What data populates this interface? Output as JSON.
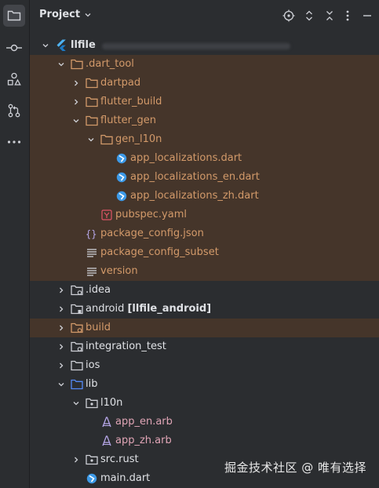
{
  "header": {
    "title": "Project",
    "icons": [
      "locate-icon",
      "expand-collapse-icon",
      "close-all-icon",
      "more-icon",
      "minimize-icon"
    ]
  },
  "sidebar": {
    "items": [
      {
        "name": "folder-icon",
        "active": true
      },
      {
        "name": "commit-icon"
      },
      {
        "name": "structure-icon"
      },
      {
        "name": "pull-requests-icon"
      },
      {
        "name": "more-tools-icon"
      }
    ]
  },
  "tree": {
    "root": "llfile",
    "rows": [
      {
        "label": ".dart_tool"
      },
      {
        "label": "dartpad"
      },
      {
        "label": "flutter_build"
      },
      {
        "label": "flutter_gen"
      },
      {
        "label": "gen_l10n"
      },
      {
        "label": "app_localizations.dart"
      },
      {
        "label": "app_localizations_en.dart"
      },
      {
        "label": "app_localizations_zh.dart"
      },
      {
        "label": "pubspec.yaml"
      },
      {
        "label": "package_config.json"
      },
      {
        "label": "package_config_subset"
      },
      {
        "label": "version"
      },
      {
        "label": ".idea"
      },
      {
        "label": "android",
        "suffix": "[llfile_android]"
      },
      {
        "label": "build"
      },
      {
        "label": "integration_test"
      },
      {
        "label": "ios"
      },
      {
        "label": "lib"
      },
      {
        "label": "l10n"
      },
      {
        "label": "app_en.arb"
      },
      {
        "label": "app_zh.arb"
      },
      {
        "label": "src.rust"
      },
      {
        "label": "main.dart"
      }
    ]
  },
  "watermark": "掘金技术社区 @ 唯有选择",
  "colors": {
    "background": "#2b2d30",
    "excluded_row": "#45352a",
    "excluded_text": "#d39a6a",
    "folder_blue": "#548af7",
    "dart_blue": "#3d9ae8"
  }
}
